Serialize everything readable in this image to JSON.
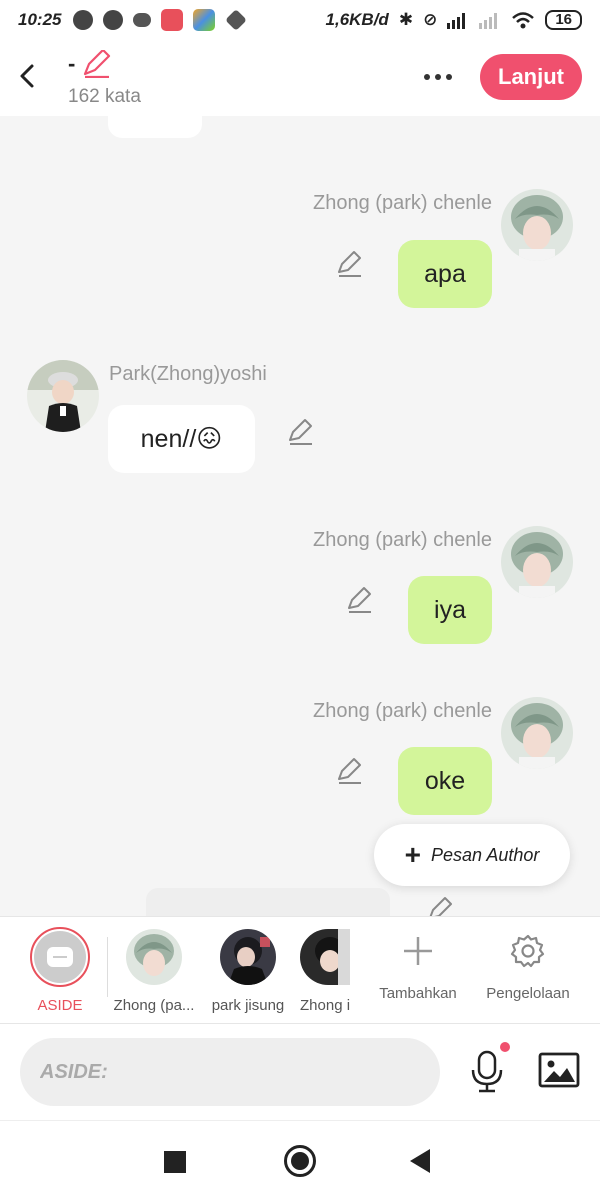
{
  "status_bar": {
    "time": "10:25",
    "network_speed": "1,6KB/d",
    "battery": "16"
  },
  "header": {
    "title": "-",
    "word_count": "162 kata",
    "next_label": "Lanjut",
    "accent_color": "#f0506e"
  },
  "messages": [
    {
      "sender": "Zhong (park) chenle",
      "text": "apa",
      "side": "right"
    },
    {
      "sender": "Park(Zhong)yoshi",
      "text": "nen//😖",
      "side": "left"
    },
    {
      "sender": "Zhong (park) chenle",
      "text": "iya",
      "side": "right"
    },
    {
      "sender": "Zhong (park) chenle",
      "text": "oke",
      "side": "right"
    }
  ],
  "author_button": {
    "label": "Pesan Author"
  },
  "characters": {
    "aside_label": "ASIDE",
    "items": [
      {
        "label": "Zhong (pa..."
      },
      {
        "label": "park jisung"
      },
      {
        "label": "Zhong i"
      }
    ],
    "add_label": "Tambahkan",
    "manage_label": "Pengelolaan"
  },
  "input": {
    "placeholder": "ASIDE:"
  },
  "icons": {
    "back": "back-icon",
    "edit": "pencil-icon",
    "more": "more-icon",
    "mic": "microphone-icon",
    "image": "image-icon",
    "settings": "gear-icon",
    "add": "plus-icon"
  }
}
